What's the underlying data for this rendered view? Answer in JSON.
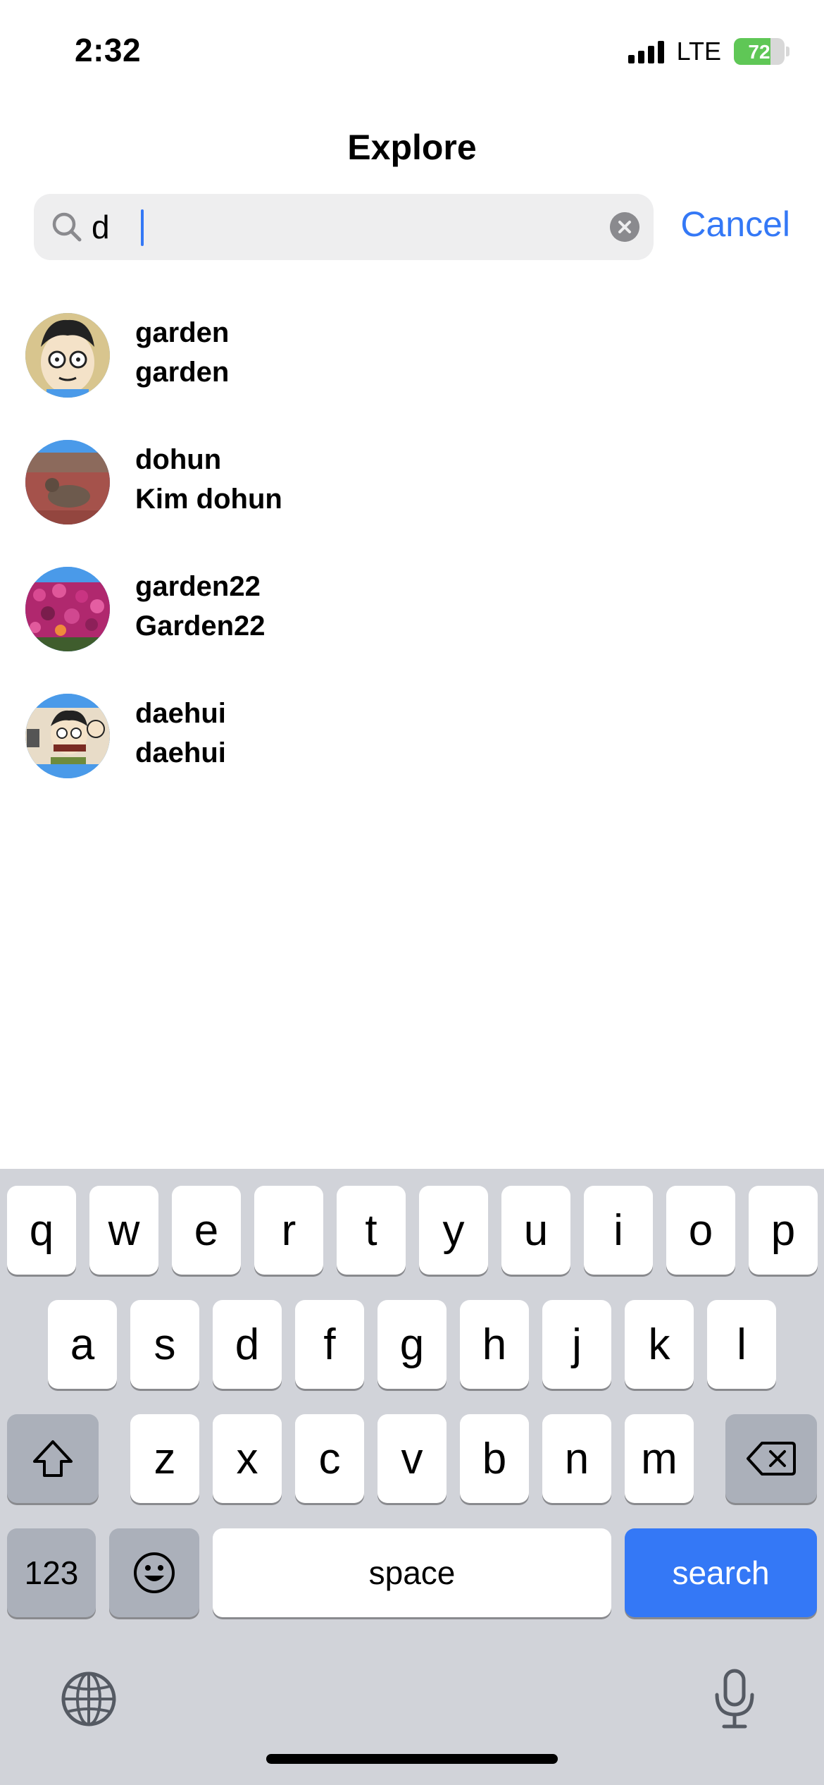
{
  "status_bar": {
    "time": "2:32",
    "network": "LTE",
    "battery": "72",
    "battery_fraction": 0.72
  },
  "header": {
    "title": "Explore"
  },
  "search": {
    "value": "d",
    "cancel_label": "Cancel"
  },
  "results": [
    {
      "username": "garden",
      "full_name": "garden",
      "avatar": "cartoon-face-avatar"
    },
    {
      "username": "dohun",
      "full_name": "Kim dohun",
      "avatar": "cat-photo-avatar"
    },
    {
      "username": "garden22",
      "full_name": "Garden22",
      "avatar": "flowers-photo-avatar"
    },
    {
      "username": "daehui",
      "full_name": "daehui",
      "avatar": "cartoon-group-avatar"
    }
  ],
  "keyboard": {
    "row1": [
      "q",
      "w",
      "e",
      "r",
      "t",
      "y",
      "u",
      "i",
      "o",
      "p"
    ],
    "row2": [
      "a",
      "s",
      "d",
      "f",
      "g",
      "h",
      "j",
      "k",
      "l"
    ],
    "row3": [
      "z",
      "x",
      "c",
      "v",
      "b",
      "n",
      "m"
    ],
    "numbers_label": "123",
    "space_label": "space",
    "action_label": "search"
  },
  "colors": {
    "accent": "#3478f6",
    "keyboard_bg": "#d1d3d9",
    "battery_green": "#5fc756"
  }
}
